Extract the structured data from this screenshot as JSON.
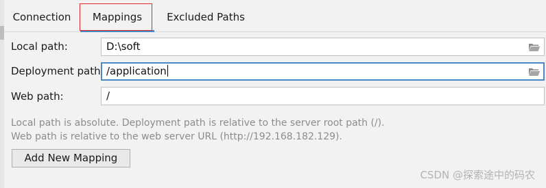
{
  "tabs": [
    {
      "label": "Connection",
      "active": false
    },
    {
      "label": "Mappings",
      "active": true
    },
    {
      "label": "Excluded Paths",
      "active": false
    }
  ],
  "fields": {
    "local_path": {
      "label": "Local path:",
      "value": "D:\\soft",
      "icon": "folder-icon"
    },
    "deployment_path": {
      "label": "Deployment path:",
      "value": "/application",
      "icon": "folder-icon",
      "focused": true
    },
    "web_path": {
      "label": "Web path:",
      "value": "/"
    }
  },
  "info": {
    "line1": "Local path is absolute. Deployment path is relative to the server root path (/).",
    "line2": "Web path is relative to the web server URL (http://192.168.182.129)."
  },
  "buttons": {
    "add_mapping": "Add New Mapping"
  },
  "watermark": "CSDN @探索途中的码农",
  "colors": {
    "accent": "#4a88c7",
    "highlight": "#e0292a",
    "background": "#f2f2f2"
  }
}
